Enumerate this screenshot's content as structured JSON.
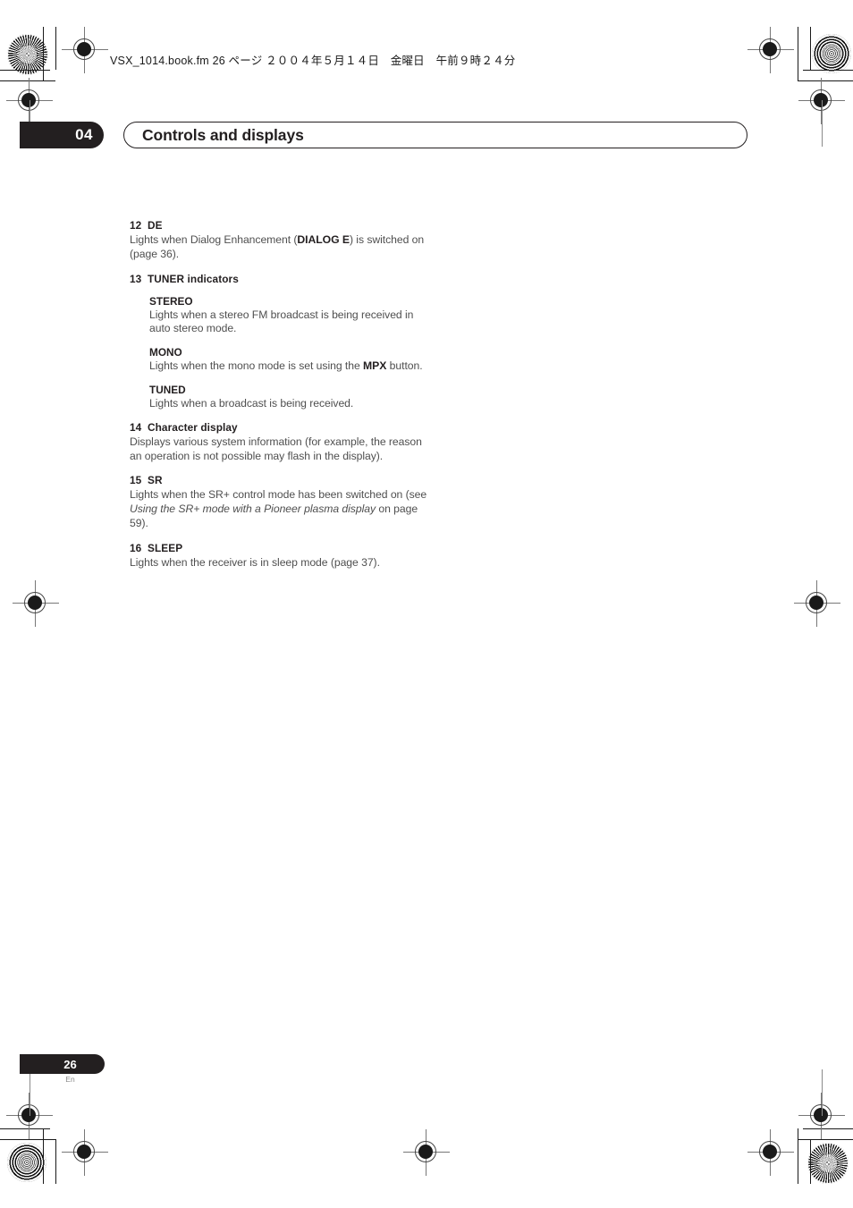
{
  "running_head": "VSX_1014.book.fm 26 ページ ２００４年５月１４日　金曜日　午前９時２４分",
  "chapter": {
    "number": "04",
    "title": "Controls and displays"
  },
  "items": [
    {
      "number": "12",
      "name": "DE",
      "body_pre": "Lights when Dialog Enhancement (",
      "body_bold": "DIALOG E",
      "body_post": ") is switched on (page 36)."
    },
    {
      "number": "13",
      "name": "TUNER indicators",
      "subitems": [
        {
          "name": "STEREO",
          "body": "Lights when a stereo FM broadcast is being received in auto stereo mode."
        },
        {
          "name": "MONO",
          "body_pre": "Lights when the mono mode is set using the ",
          "body_bold": "MPX",
          "body_post": " button."
        },
        {
          "name": "TUNED",
          "body": "Lights when a broadcast is being received."
        }
      ]
    },
    {
      "number": "14",
      "name": "Character display",
      "body": "Displays various system information (for example, the reason an operation is not possible may flash in the display)."
    },
    {
      "number": "15",
      "name": "SR",
      "body_pre": "Lights when the SR+ control mode has been switched on (see ",
      "body_italic": "Using the SR+ mode with a Pioneer plasma display",
      "body_post": " on page 59)."
    },
    {
      "number": "16",
      "name": "SLEEP",
      "body": "Lights when the receiver is in sleep mode (page 37)."
    }
  ],
  "footer": {
    "page_number": "26",
    "language": "En"
  },
  "colors": {
    "ink": "#231f20",
    "body_text": "#4f4f4f",
    "muted": "#8a8a8a"
  }
}
